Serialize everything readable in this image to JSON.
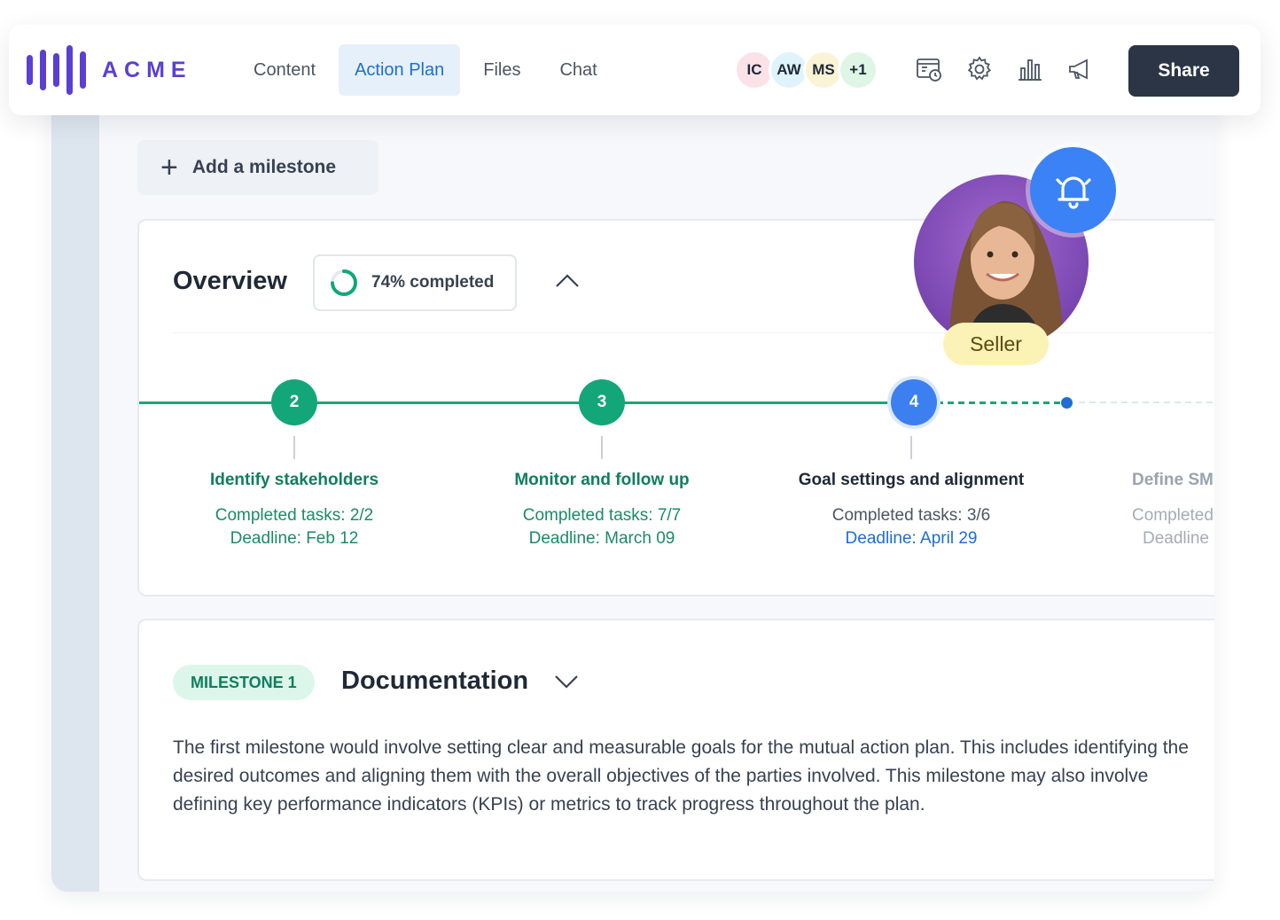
{
  "brand": {
    "name": "ACME",
    "color": "#5b3fd3"
  },
  "nav": {
    "tabs": [
      {
        "label": "Content",
        "active": false
      },
      {
        "label": "Action Plan",
        "active": true
      },
      {
        "label": "Files",
        "active": false
      },
      {
        "label": "Chat",
        "active": false
      }
    ],
    "avatars": [
      {
        "initials": "IC",
        "color": "#fbe2e8"
      },
      {
        "initials": "AW",
        "color": "#dff3fb"
      },
      {
        "initials": "MS",
        "color": "#fbf3d5"
      },
      {
        "initials": "+1",
        "color": "#dff6e6"
      }
    ],
    "icons": [
      "calendar-clock-icon",
      "gear-icon",
      "bar-chart-icon",
      "megaphone-icon"
    ],
    "share_label": "Share"
  },
  "add_milestone": {
    "label": "Add a milestone",
    "icon": "plus-icon"
  },
  "overview": {
    "title": "Overview",
    "progress_label": "74% completed",
    "progress_fraction": 0.74,
    "milestones": [
      {
        "number": "2",
        "name": "Identify stakeholders",
        "tasks": "Completed tasks: 2/2",
        "deadline": "Deadline: Feb 12",
        "status": "done"
      },
      {
        "number": "3",
        "name": "Monitor and follow up",
        "tasks": "Completed tasks: 7/7",
        "deadline": "Deadline: March 09",
        "status": "done"
      },
      {
        "number": "4",
        "name": "Goal settings and alignment",
        "tasks": "Completed tasks: 3/6",
        "deadline": "Deadline: April 29",
        "status": "current"
      },
      {
        "number": "",
        "name": "Define SM",
        "tasks": "Completed",
        "deadline": "Deadline",
        "status": "upcoming"
      }
    ]
  },
  "seller": {
    "label": "Seller",
    "icon": "bell-icon"
  },
  "documentation": {
    "badge": "MILESTONE 1",
    "title": "Documentation",
    "body": "The first milestone would involve setting clear and measurable goals for the mutual action plan. This includes identifying the desired outcomes and aligning them with the overall objectives of the parties involved. This milestone may also involve defining key performance indicators (KPIs) or metrics to track progress throughout the plan."
  },
  "colors": {
    "accent_blue": "#1d6fd1",
    "success_green": "#13a679",
    "share_button": "#2b3545",
    "bell_blue": "#3b82f6",
    "seller_tag": "#fbf2b6"
  }
}
